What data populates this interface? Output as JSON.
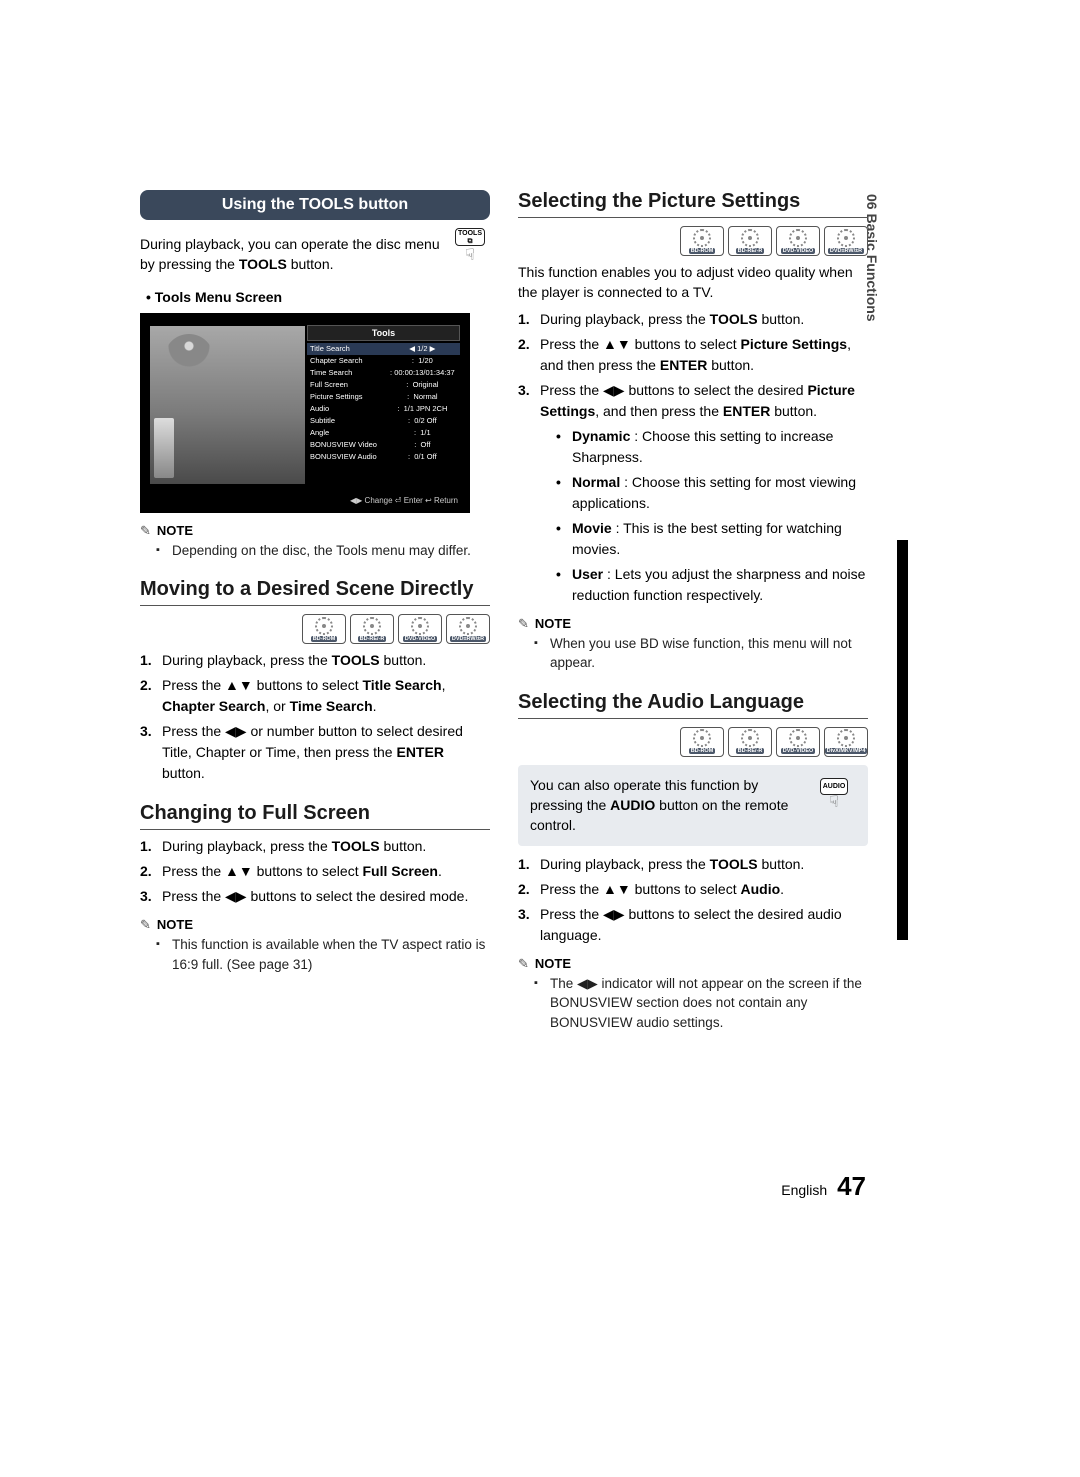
{
  "side_tab": "06  Basic Functions",
  "footer": {
    "lang": "English",
    "page": "47"
  },
  "left": {
    "band": "Using the TOOLS button",
    "intro_a": "During playback, you can operate the disc menu by pressing the ",
    "intro_b": "TOOLS",
    "intro_c": " button.",
    "tools_key_label": "TOOLS",
    "bullet_screen": "• Tools Menu Screen",
    "screen": {
      "title": "Tools",
      "rows": [
        {
          "k": "Title Search",
          "v": "1/2",
          "hl": true,
          "arrows": true
        },
        {
          "k": "Chapter Search",
          "sep": ":",
          "v": "1/20"
        },
        {
          "k": "Time Search",
          "sep": ":",
          "v": "00:00:13/01:34:37"
        },
        {
          "k": "Full Screen",
          "sep": ":",
          "v": "Original"
        },
        {
          "k": "Picture Settings",
          "sep": ":",
          "v": "Normal"
        },
        {
          "k": "Audio",
          "sep": ":",
          "v": "1/1 JPN 2CH"
        },
        {
          "k": "Subtitle",
          "sep": ":",
          "v": "0/2 Off"
        },
        {
          "k": "Angle",
          "sep": ":",
          "v": "1/1"
        },
        {
          "k": "BONUSVIEW Video",
          "sep": ":",
          "v": "Off"
        },
        {
          "k": "BONUSVIEW Audio",
          "sep": ":",
          "v": "0/1 Off"
        }
      ],
      "bottom": "◀▶ Change    ⏎ Enter    ↩ Return"
    },
    "note1_head": "NOTE",
    "note1_item": "Depending on the disc, the Tools menu may differ.",
    "h_move": "Moving to a Desired Scene Directly",
    "move_badges": [
      "BD-ROM",
      "BD-RE/-R",
      "DVD-VIDEO",
      "DVD±RW/±R"
    ],
    "move_steps_1a": "During playback, press the ",
    "move_steps_1b": "TOOLS",
    "move_steps_1c": " button.",
    "move_steps_2a": "Press the ▲▼ buttons to select ",
    "move_steps_2b": "Title Search",
    "move_steps_2c": ", ",
    "move_steps_2d": "Chapter Search",
    "move_steps_2e": ", or ",
    "move_steps_2f": "Time Search",
    "move_steps_2g": ".",
    "move_steps_3a": "Press the ◀▶ or number button to select desired Title, Chapter or Time, then press the ",
    "move_steps_3b": "ENTER",
    "move_steps_3c": " button.",
    "h_full": "Changing to Full Screen",
    "full_1a": "During playback, press the ",
    "full_1b": "TOOLS",
    "full_1c": " button.",
    "full_2a": "Press the ▲▼ buttons to select ",
    "full_2b": "Full Screen",
    "full_2c": ".",
    "full_3": "Press the ◀▶ buttons to select the desired mode.",
    "note2_head": "NOTE",
    "note2_item": "This function is available when the TV aspect ratio is 16:9 full. (See page 31)"
  },
  "right": {
    "h_pic": "Selecting the Picture Settings",
    "pic_badges": [
      "BD-ROM",
      "BD-RE/-R",
      "DVD-VIDEO",
      "DVD±RW/±R"
    ],
    "pic_intro": "This function enables you to adjust video quality when the player is connected to a TV.",
    "pic_1a": "During playback, press the ",
    "pic_1b": "TOOLS",
    "pic_1c": " button.",
    "pic_2a": "Press the ▲▼ buttons to select ",
    "pic_2b": "Picture Settings",
    "pic_2c": ", and then press the ",
    "pic_2d": "ENTER",
    "pic_2e": " button.",
    "pic_3a": "Press the ◀▶ buttons to select the desired ",
    "pic_3b": "Picture Settings",
    "pic_3c": ", and then press the ",
    "pic_3d": "ENTER",
    "pic_3e": " button.",
    "pic_d1a": "Dynamic",
    "pic_d1b": " : Choose this setting to increase Sharpness.",
    "pic_d2a": "Normal",
    "pic_d2b": " : Choose this setting for most viewing applications.",
    "pic_d3a": "Movie",
    "pic_d3b": " : This is the best setting for watching movies.",
    "pic_d4a": "User",
    "pic_d4b": " : Lets you adjust the sharpness and noise reduction function respectively.",
    "note3_head": "NOTE",
    "note3_item": "When you use BD wise function, this menu will not appear.",
    "h_audio": "Selecting the Audio Language",
    "audio_badges": [
      "BD-ROM",
      "BD-RE/-R",
      "DVD-VIDEO",
      "DivX/MKV/MP4"
    ],
    "audio_box_a": "You can also operate this function by pressing the ",
    "audio_box_b": "AUDIO",
    "audio_box_c": " button on the remote control.",
    "audio_key_label": "AUDIO",
    "audio_1a": "During playback, press the ",
    "audio_1b": "TOOLS",
    "audio_1c": " button.",
    "audio_2a": "Press the ▲▼ buttons to select ",
    "audio_2b": "Audio",
    "audio_2c": ".",
    "audio_3": "Press the ◀▶ buttons to select the desired audio language.",
    "note4_head": "NOTE",
    "note4_item": "The ◀▶ indicator will not appear on the screen if the BONUSVIEW section does not contain any BONUSVIEW audio settings."
  }
}
